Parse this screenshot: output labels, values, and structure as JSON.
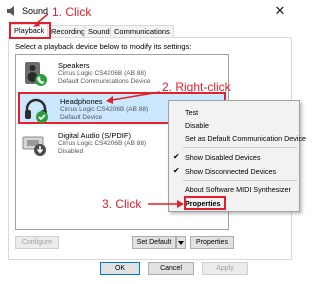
{
  "window": {
    "title": "Sound",
    "close_glyph": "✕"
  },
  "tabs": [
    {
      "label": "Playback"
    },
    {
      "label": "Recording"
    },
    {
      "label": "Sounds"
    },
    {
      "label": "Communications"
    }
  ],
  "instruction": "Select a playback device below to modify its settings:",
  "devices": [
    {
      "name": "Speakers",
      "description": "Cirrus Logic CS4206B (AB 88)",
      "status": "Default Communications Device",
      "icon": "speaker-icon",
      "badge": "phone-badge"
    },
    {
      "name": "Headphones",
      "description": "Cirrus Logic CS4206B (AB 88)",
      "status": "Default Device",
      "icon": "headphones-icon",
      "badge": "check-badge"
    },
    {
      "name": "Digital Audio (S/PDIF)",
      "description": "Cirrus Logic CS4206B (AB 88)",
      "status": "Disabled",
      "icon": "digital-audio-icon",
      "badge": "down-arrow-badge"
    }
  ],
  "context_menu": {
    "items": [
      {
        "label": "Test"
      },
      {
        "label": "Disable"
      },
      {
        "label": "Set as Default Communication Device"
      },
      {
        "label": "Show Disabled Devices",
        "checked": true
      },
      {
        "label": "Show Disconnected Devices",
        "checked": true
      },
      {
        "label": "About Software MIDI Synthesizer"
      },
      {
        "label": "Properties"
      }
    ]
  },
  "buttons": {
    "configure": "Configure",
    "set_default": "Set Default",
    "properties": "Properties",
    "ok": "OK",
    "cancel": "Cancel",
    "apply": "Apply"
  },
  "annotations": {
    "step1": "1. Click",
    "step2": "2. Right-click",
    "step3": "3. Click",
    "color": "#e0202a"
  },
  "colors": {
    "selection": "#cce8ff",
    "badge_green": "#2e9e3c",
    "accent": "#0078d7"
  }
}
